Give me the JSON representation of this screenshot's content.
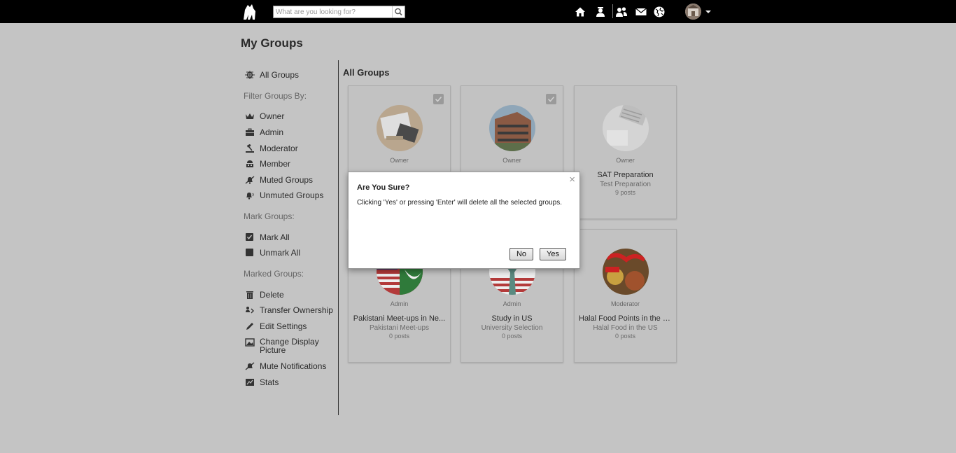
{
  "topbar": {
    "search_placeholder": "What are you looking for?",
    "icons": [
      "logo-icon",
      "search-icon",
      "home-icon",
      "profile-icon",
      "friends-icon",
      "mail-icon",
      "globe-icon",
      "user-avatar",
      "chevron-down-icon"
    ]
  },
  "page": {
    "title": "My Groups"
  },
  "sidebar": {
    "all_groups": "All Groups",
    "filter_heading": "Filter Groups By:",
    "filters": [
      "Owner",
      "Admin",
      "Moderator",
      "Member",
      "Muted Groups",
      "Unmuted Groups"
    ],
    "mark_heading": "Mark Groups:",
    "mark_actions": [
      "Mark All",
      "Unmark All"
    ],
    "marked_heading": "Marked Groups:",
    "marked_actions": [
      "Delete",
      "Transfer Ownership",
      "Edit Settings",
      "Change Display Picture",
      "Mute Notifications",
      "Stats"
    ]
  },
  "content": {
    "title": "All Groups",
    "groups": [
      {
        "role": "Owner",
        "name": "",
        "category": "",
        "posts": "",
        "checked": true
      },
      {
        "role": "Owner",
        "name": "",
        "category": "",
        "posts": "",
        "checked": true
      },
      {
        "role": "Owner",
        "name": "SAT Preparation",
        "category": "Test Preparation",
        "posts": "9 posts",
        "checked": false
      },
      {
        "role": "Admin",
        "name": "Pakistani Meet-ups in Ne...",
        "category": "Pakistani Meet-ups",
        "posts": "0 posts",
        "checked": false
      },
      {
        "role": "Admin",
        "name": "Study in US",
        "category": "University Selection",
        "posts": "0 posts",
        "checked": false
      },
      {
        "role": "Moderator",
        "name": "Halal Food Points in the US",
        "category": "Halal Food in the US",
        "posts": "0 posts",
        "checked": false
      }
    ]
  },
  "modal": {
    "title": "Are You Sure?",
    "body": "Clicking 'Yes' or pressing 'Enter' will delete all the selected groups.",
    "close": "×",
    "no": "No",
    "yes": "Yes"
  },
  "colors": {
    "topbar": "#000000",
    "page_bg": "#c4c4c4",
    "modal_bg": "#ffffff"
  }
}
